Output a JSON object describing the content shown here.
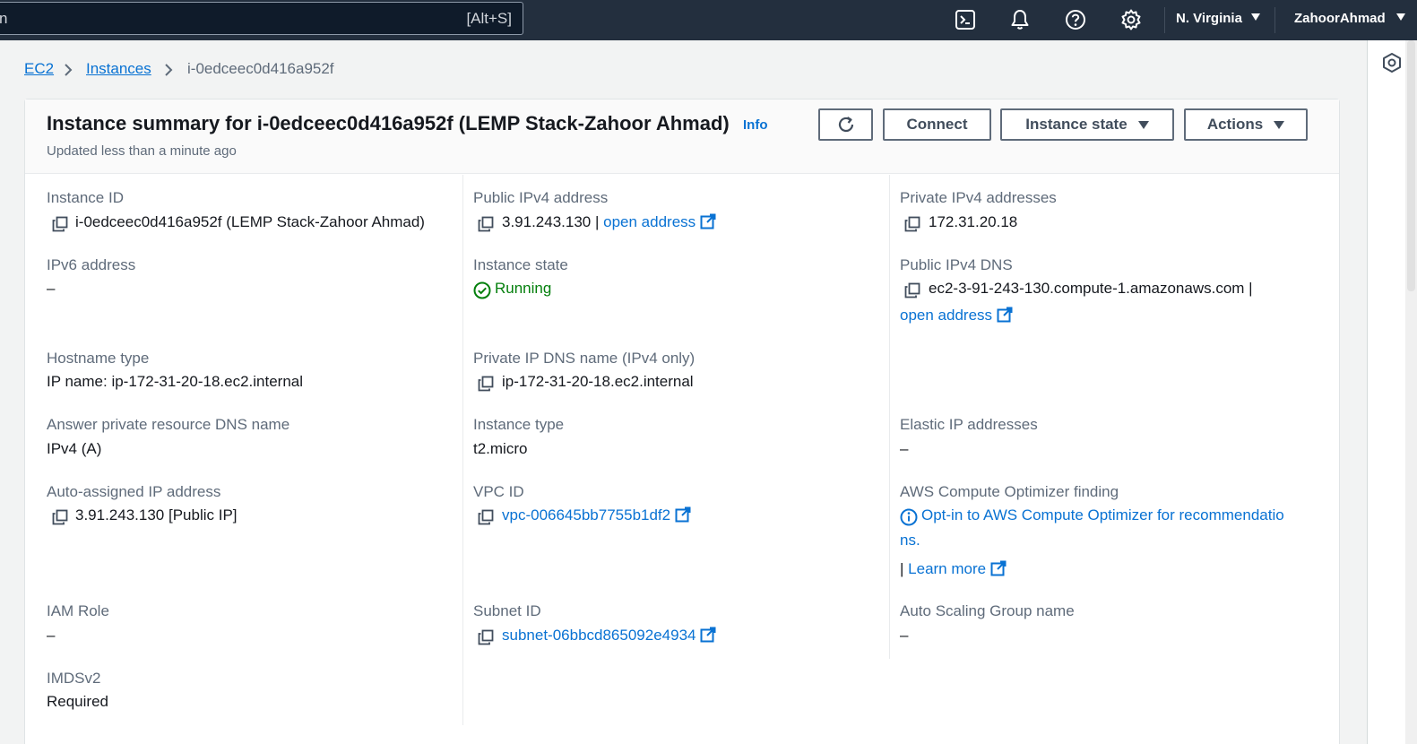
{
  "topbar": {
    "search_glyph": "n",
    "search_shortcut": "[Alt+S]",
    "region": "N. Virginia",
    "user": "ZahoorAhmad",
    "icons": [
      "cloudshell-icon",
      "bell-icon",
      "help-icon",
      "settings-icon"
    ]
  },
  "breadcrumb": {
    "ec2": "EC2",
    "instances": "Instances",
    "current": "i-0edceec0d416a952f"
  },
  "summary": {
    "title": "Instance summary for i-0edceec0d416a952f (LEMP Stack-Zahoor Ahmad)",
    "info": "Info",
    "updated": "Updated less than a minute ago",
    "buttons": {
      "connect": "Connect",
      "instance_state": "Instance state",
      "actions": "Actions"
    }
  },
  "fields": {
    "instance_id": {
      "label": "Instance ID",
      "value": "i-0edceec0d416a952f (LEMP Stack-Zahoor Ahmad)"
    },
    "public_ipv4": {
      "label": "Public IPv4 address",
      "value": "3.91.243.130 |",
      "link": "open address"
    },
    "private_ipv4": {
      "label": "Private IPv4 addresses",
      "value": "172.31.20.18"
    },
    "ipv6": {
      "label": "IPv6 address",
      "value": "–"
    },
    "instance_state": {
      "label": "Instance state",
      "value": "Running"
    },
    "public_dns": {
      "label": "Public IPv4 DNS",
      "value": "ec2-3-91-243-130.compute-1.amazonaws.com |",
      "link": "open address"
    },
    "hostname_type": {
      "label": "Hostname type",
      "value": "IP name: ip-172-31-20-18.ec2.internal"
    },
    "private_dns": {
      "label": "Private IP DNS name (IPv4 only)",
      "value": "ip-172-31-20-18.ec2.internal"
    },
    "answer_dns": {
      "label": "Answer private resource DNS name",
      "value": "IPv4 (A)"
    },
    "instance_type": {
      "label": "Instance type",
      "value": "t2.micro"
    },
    "elastic_ip": {
      "label": "Elastic IP addresses",
      "value": "–"
    },
    "auto_ip": {
      "label": "Auto-assigned IP address",
      "value": "3.91.243.130 [Public IP]"
    },
    "vpc_id": {
      "label": "VPC ID",
      "value": "vpc-006645bb7755b1df2"
    },
    "optimizer": {
      "label": "AWS Compute Optimizer finding",
      "line1": "Opt-in to AWS Compute Optimizer for recommendatio",
      "line2": "ns.",
      "sep": "|",
      "learn_more": "Learn more"
    },
    "iam_role": {
      "label": "IAM Role",
      "value": "–"
    },
    "subnet_id": {
      "label": "Subnet ID",
      "value": "subnet-06bbcd865092e4934"
    },
    "asg_name": {
      "label": "Auto Scaling Group name",
      "value": "–"
    },
    "imdsv2": {
      "label": "IMDSv2",
      "value": "Required"
    }
  },
  "colors": {
    "topbar": "#232f3e",
    "link": "#0972d3",
    "success": "#037f0c",
    "label": "#5f6b7a"
  }
}
